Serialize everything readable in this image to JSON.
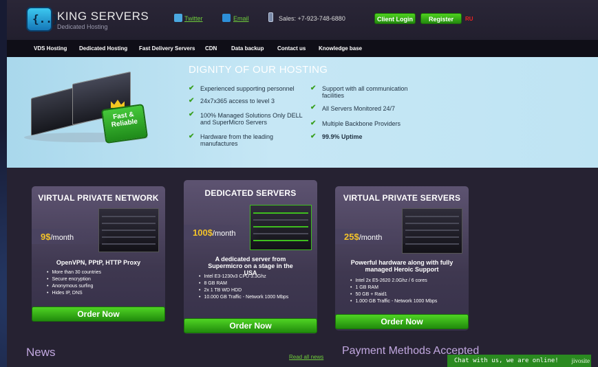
{
  "header": {
    "logo_title": "KING SERVERS",
    "logo_sub": "Dedicated Hosting",
    "logo_glyph": "{..}",
    "twitter": "Twitter",
    "email": "Email",
    "sales": "Sales: +7-923-748-6880",
    "client_login": "Client Login",
    "register": "Register",
    "lang": "RU"
  },
  "nav": [
    "VDS Hosting",
    "Dedicated Hosting",
    "Fast Delivery Servers",
    "CDN",
    "Data backup",
    "Contact us",
    "Knowledge base"
  ],
  "banner": {
    "title": "DIGNITY OF OUR HOSTING",
    "badge": "Fast & Reliable",
    "left": [
      "Experienced supporting personnel",
      "24x7x365 access to level 3",
      "100% Managed Solutions Only DELL and SuperMicro Servers",
      "Hardware from the leading manufactures"
    ],
    "right": [
      "Support with all communication facilities",
      "All Servers Monitored 24/7",
      "Multiple Backbone Providers",
      "99.9% Uptime"
    ]
  },
  "cards": [
    {
      "title": "VIRTUAL PRIVATE NETWORK",
      "price": "9$",
      "per": "/month",
      "desc": "OpenVPN, PPtP, HTTP Proxy",
      "items": [
        "More than 30 countries",
        "Secure encryption",
        "Anonymous surfing",
        "Hides IP, DNS"
      ],
      "order": "Order Now"
    },
    {
      "title": "DEDICATED SERVERS",
      "price": "100$",
      "per": "/month",
      "desc": "A dedicated server from Supermicro on a stage in the USA",
      "items": [
        "Intel E3-1230v3 CPU 3.3Ghz",
        "8 GB RAM",
        "2x 1 TB WD HDD",
        "10.000 GB Traffic - Network 1000 Mbps"
      ],
      "order": "Order Now"
    },
    {
      "title": "VIRTUAL PRIVATE SERVERS",
      "price": "25$",
      "per": "/month",
      "desc": "Powerful hardware along with fully managed Heroic Support",
      "items": [
        "Intel 2x E5-2620 2.0Ghz / 6 cores",
        "1 GB RAM",
        "50 GB + Raid1",
        "1.000 GB Traffic - Network 1000 Mbps"
      ],
      "order": "Order Now"
    }
  ],
  "bottom": {
    "news": "News",
    "read_all": "Read all news",
    "payment": "Payment Methods Accepted",
    "chat": "Chat with us, we are online!",
    "chat_brand": "jivosite"
  },
  "colors": {
    "accent_green": "#3fbf1f",
    "price_gold": "#f3c32a",
    "banner_bg": "#bfe4f3"
  }
}
